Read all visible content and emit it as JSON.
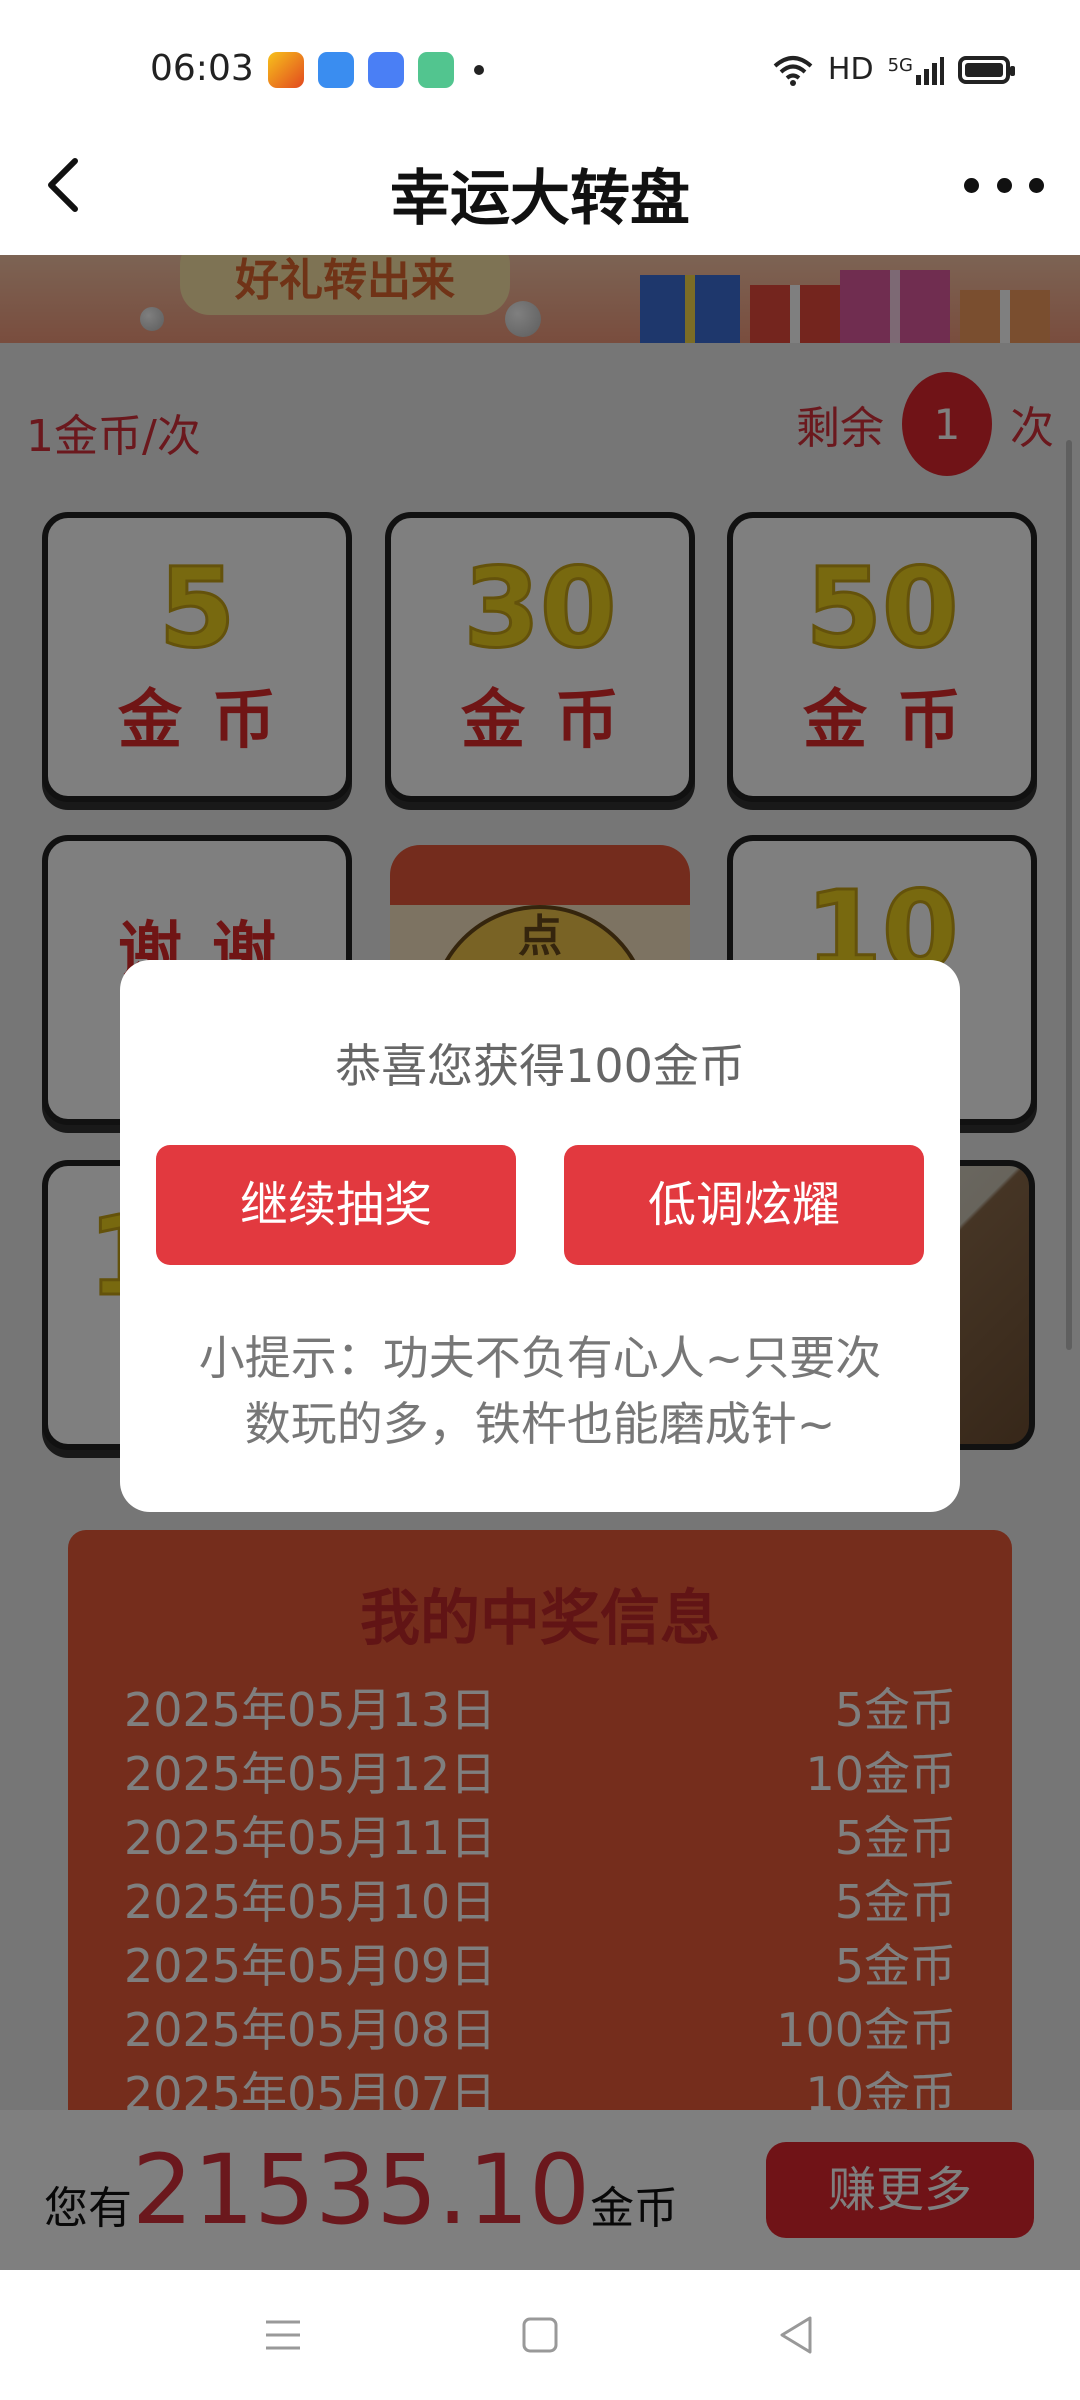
{
  "status_bar": {
    "time": "06:03",
    "network": "HD",
    "signal": "5G",
    "app_icons": [
      "app-icon-orange",
      "weather-icon",
      "chat-icon",
      "upload-icon"
    ]
  },
  "nav": {
    "title": "幸运大转盘",
    "back_icon": "chevron-left-icon",
    "more_icon": "more-dots-icon"
  },
  "banner": {
    "slogan": "好礼转出来"
  },
  "game": {
    "price": "1金币/次",
    "remain_prefix": "剩余",
    "remain_count": "1",
    "remain_suffix": "次",
    "prizes": [
      {
        "amount": "5",
        "unit": "金币"
      },
      {
        "amount": "30",
        "unit": "金币"
      },
      {
        "amount": "50",
        "unit": "金币"
      },
      {
        "text": "谢谢"
      },
      {
        "amount": "10"
      },
      {
        "amount": "1"
      }
    ],
    "center_label": "点"
  },
  "win_info": {
    "title": "我的中奖信息",
    "rows": [
      {
        "date": "2025年05月13日",
        "amount": "5金币"
      },
      {
        "date": "2025年05月12日",
        "amount": "10金币"
      },
      {
        "date": "2025年05月11日",
        "amount": "5金币"
      },
      {
        "date": "2025年05月10日",
        "amount": "5金币"
      },
      {
        "date": "2025年05月09日",
        "amount": "5金币"
      },
      {
        "date": "2025年05月08日",
        "amount": "100金币"
      },
      {
        "date": "2025年05月07日",
        "amount": "10金币"
      }
    ]
  },
  "bottom_bar": {
    "balance_prefix": "您有",
    "balance": "21535.10",
    "balance_unit": "金币",
    "earn_more": "赚更多"
  },
  "dialog": {
    "message": "恭喜您获得100金币",
    "continue_button": "继续抽奖",
    "share_button": "低调炫耀",
    "tip": "小提示：功夫不负有心人~只要次数玩的多，铁杵也能磨成针~"
  },
  "colors": {
    "accent_red": "#e2393f",
    "panel_orange": "#ea5a38",
    "prize_yellow": "#f1d21f"
  }
}
